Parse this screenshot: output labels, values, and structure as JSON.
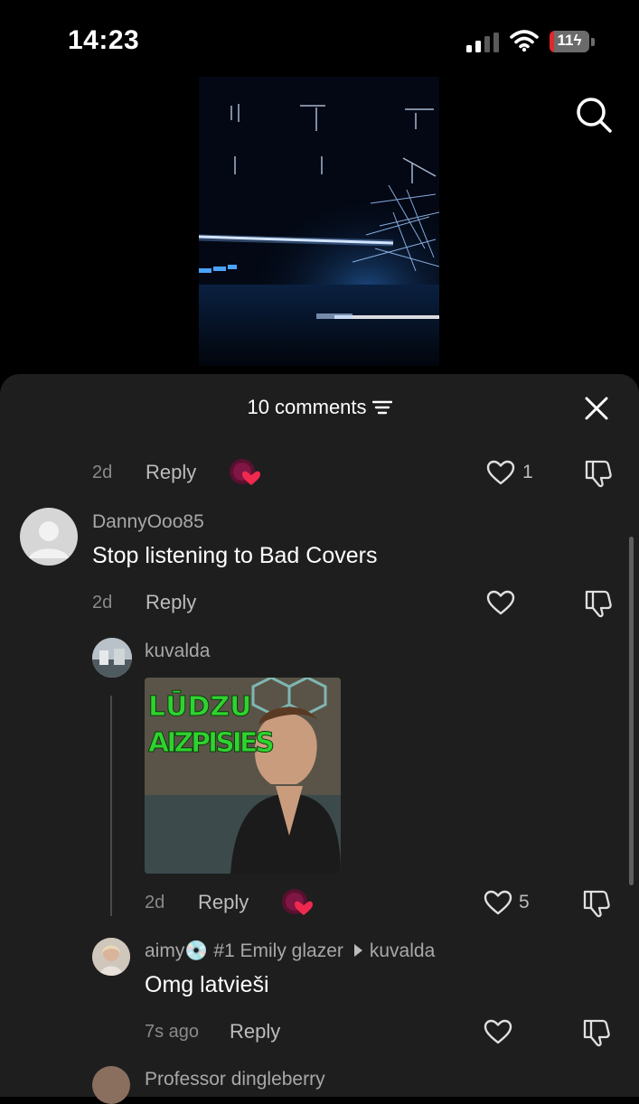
{
  "status_bar": {
    "time": "14:23",
    "battery": "11",
    "battery_fraction": 0.11
  },
  "header": {
    "comments_count": "10 comments"
  },
  "comments": [
    {
      "time": "2d",
      "reply_label": "Reply",
      "likes": "1"
    },
    {
      "username": "DannyOoo85",
      "text": "Stop listening to Bad Covers",
      "time": "2d",
      "reply_label": "Reply"
    },
    {
      "username": "kuvalda",
      "gif_text_1": "LŪDZU",
      "gif_text_2": "AIZPISIES",
      "time": "2d",
      "reply_label": "Reply",
      "likes": "5"
    },
    {
      "username": "aimy💿 #1 Emily glazer",
      "reply_to": "kuvalda",
      "text": "Omg latvieši",
      "time": "7s ago",
      "reply_label": "Reply"
    },
    {
      "username": "Professor dingleberry"
    }
  ],
  "icons": {
    "search": "search-icon",
    "filter": "filter-icon",
    "close": "close-icon",
    "like": "heart-outline-icon",
    "dislike": "thumbs-down-icon"
  },
  "colors": {
    "sheet_bg": "#1e1e1e",
    "battery_low": "#e0272c",
    "heart_badge": "#f0294f"
  }
}
